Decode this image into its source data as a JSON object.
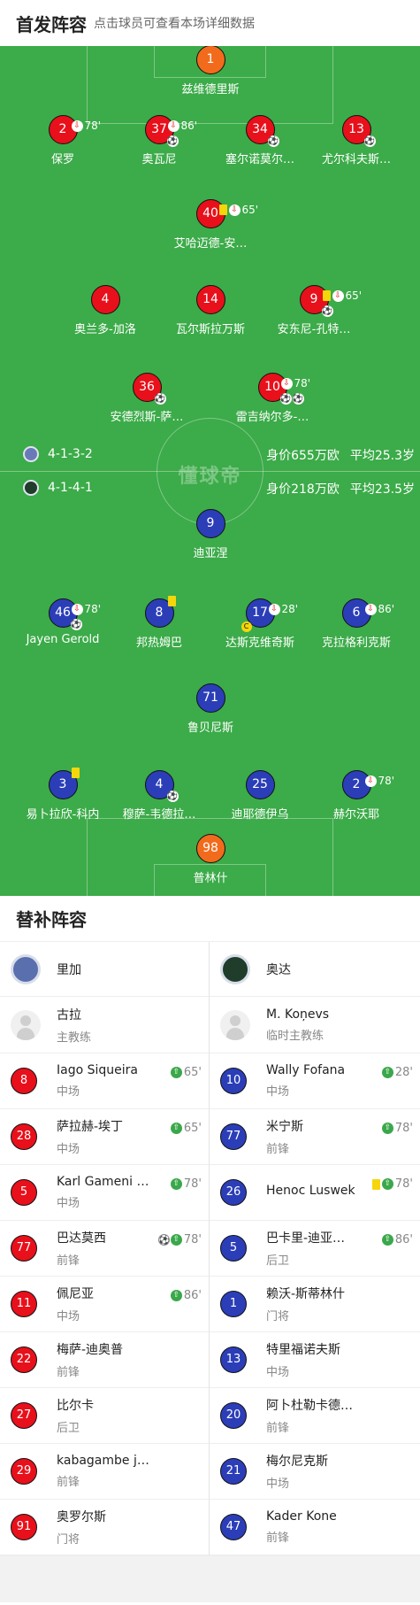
{
  "header": {
    "title": "首发阵容",
    "subtitle": "点击球员可查看本场详细数据"
  },
  "watermark": "懂球帝",
  "home_info": {
    "formation": "4-1-3-2",
    "value": "身价655万欧",
    "age": "平均25.3岁"
  },
  "away_info": {
    "formation": "4-1-4-1",
    "value": "身价218万欧",
    "age": "平均23.5岁"
  },
  "pitch": {
    "p1": {
      "num": "1",
      "name": "兹维德里斯"
    },
    "p2": {
      "num": "2",
      "name": "保罗",
      "time": "78'"
    },
    "p3": {
      "num": "37",
      "name": "奥瓦尼",
      "time": "86'"
    },
    "p4": {
      "num": "34",
      "name": "塞尔诺莫尔…"
    },
    "p5": {
      "num": "13",
      "name": "尤尔科夫斯…"
    },
    "p6": {
      "num": "40",
      "name": "艾哈迈德-安…",
      "time": "65'"
    },
    "p7": {
      "num": "4",
      "name": "奥兰多-加洛"
    },
    "p8": {
      "num": "14",
      "name": "瓦尔斯拉万斯"
    },
    "p9": {
      "num": "9",
      "name": "安东尼-孔特…",
      "time": "65'"
    },
    "p10": {
      "num": "36",
      "name": "安德烈斯-萨…"
    },
    "p11": {
      "num": "10",
      "name": "雷吉纳尔多-…",
      "time": "78'"
    },
    "a1": {
      "num": "9",
      "name": "迪亚涅"
    },
    "a2": {
      "num": "46",
      "name": "Jayen Gerold",
      "time": "78'"
    },
    "a3": {
      "num": "8",
      "name": "邦热姆巴"
    },
    "a4": {
      "num": "17",
      "name": "达斯克维奇斯",
      "time": "28'"
    },
    "a5": {
      "num": "6",
      "name": "克拉格利克斯",
      "time": "86'"
    },
    "a6": {
      "num": "71",
      "name": "鲁贝尼斯"
    },
    "a7": {
      "num": "3",
      "name": "易卜拉欣-科内"
    },
    "a8": {
      "num": "4",
      "name": "穆萨-韦德拉…"
    },
    "a9": {
      "num": "25",
      "name": "迪耶德伊乌"
    },
    "a10": {
      "num": "2",
      "name": "赫尔沃耶",
      "time": "78'"
    },
    "a11": {
      "num": "98",
      "name": "普林什"
    }
  },
  "subs": {
    "title": "替补阵容",
    "home": {
      "team": "里加",
      "coach": {
        "name": "古拉",
        "role": "主教练"
      },
      "players": [
        {
          "num": "8",
          "name": "Iago Siqueira",
          "pos": "中场",
          "time": "65'"
        },
        {
          "num": "28",
          "name": "萨拉赫-埃丁",
          "pos": "中场",
          "time": "65'"
        },
        {
          "num": "5",
          "name": "Karl Gameni …",
          "pos": "中场",
          "time": "78'"
        },
        {
          "num": "77",
          "name": "巴达莫西",
          "pos": "前锋",
          "time": "78'"
        },
        {
          "num": "11",
          "name": "佩尼亚",
          "pos": "中场",
          "time": "86'"
        },
        {
          "num": "22",
          "name": "梅萨-迪奥普",
          "pos": "前锋"
        },
        {
          "num": "27",
          "name": "比尔卡",
          "pos": "后卫"
        },
        {
          "num": "29",
          "name": "kabagambe j…",
          "pos": "前锋"
        },
        {
          "num": "91",
          "name": "奥罗尔斯",
          "pos": "门将"
        }
      ]
    },
    "away": {
      "team": "奥达",
      "coach": {
        "name": "M. Koņevs",
        "role": "临时主教练"
      },
      "players": [
        {
          "num": "10",
          "name": "Wally Fofana",
          "pos": "中场",
          "time": "28'"
        },
        {
          "num": "77",
          "name": "米宁斯",
          "pos": "前锋",
          "time": "78'"
        },
        {
          "num": "26",
          "name": "Henoc Luswek",
          "pos": "",
          "time": "78'"
        },
        {
          "num": "5",
          "name": "巴卡里-迪亚…",
          "pos": "后卫",
          "time": "86'"
        },
        {
          "num": "1",
          "name": "赖沃-斯蒂林什",
          "pos": "门将"
        },
        {
          "num": "13",
          "name": "特里福诺夫斯",
          "pos": "中场"
        },
        {
          "num": "20",
          "name": "阿卜杜勒卡德…",
          "pos": "前锋"
        },
        {
          "num": "21",
          "name": "梅尔尼克斯",
          "pos": "中场"
        },
        {
          "num": "47",
          "name": "Kader Kone",
          "pos": "前锋"
        }
      ]
    }
  },
  "colors": {
    "pitch": "#3cab49",
    "home": "#e8101b",
    "away": "#2b3eb8",
    "keeper": "#f26b1c",
    "sub_in": "#3aa84a"
  }
}
